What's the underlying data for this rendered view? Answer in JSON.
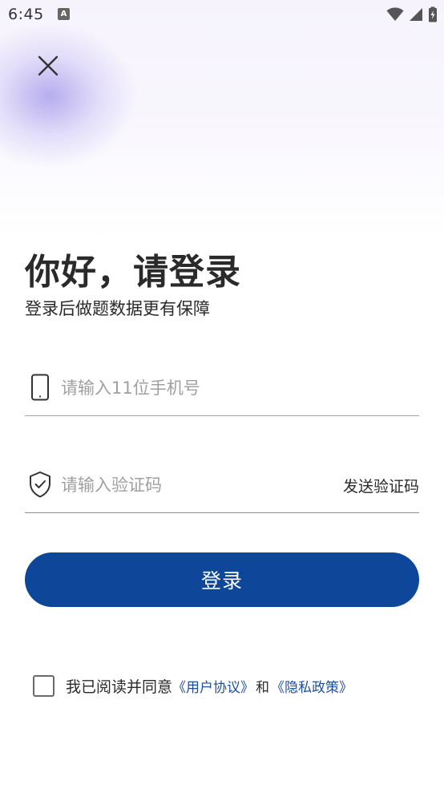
{
  "status_bar": {
    "time": "6:45",
    "notification_icon": "a-notification-icon"
  },
  "header": {
    "close_icon": "close-icon"
  },
  "title": "你好，请登录",
  "subtitle": "登录后做题数据更有保障",
  "phone_field": {
    "icon": "phone-icon",
    "placeholder": "请输入11位手机号",
    "value": ""
  },
  "code_field": {
    "icon": "shield-check-icon",
    "placeholder": "请输入验证码",
    "value": "",
    "send_code_label": "发送验证码"
  },
  "login_button": {
    "label": "登录",
    "color": "#0e4699"
  },
  "agreement": {
    "prefix": "我已阅读并同意",
    "user_agreement": "《用户协议》",
    "and": "和",
    "privacy_policy": "《隐私政策》",
    "link_color": "#1f4f9a"
  }
}
